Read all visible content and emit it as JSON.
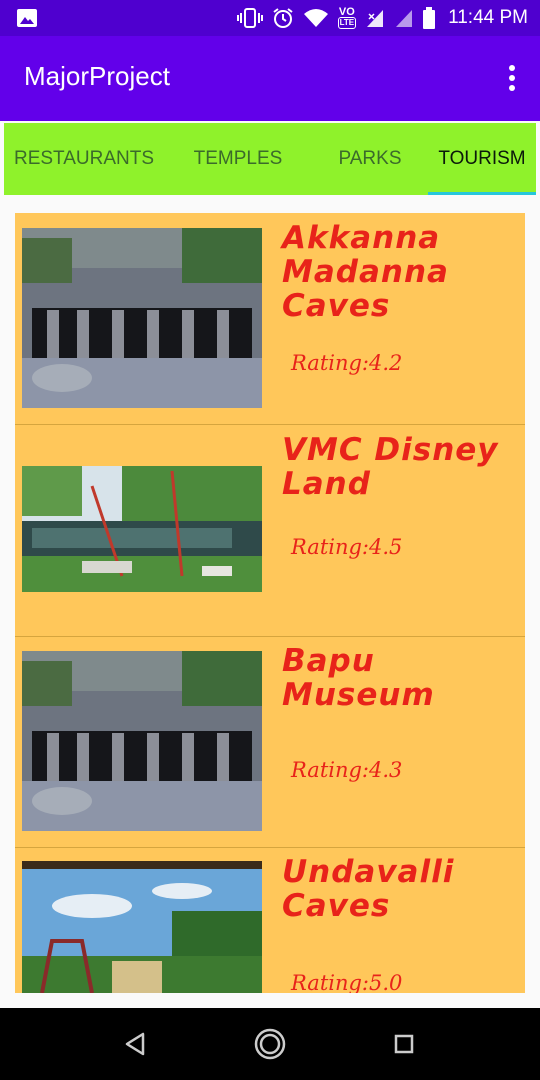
{
  "status_bar": {
    "time": "11:44 PM",
    "icons": [
      "gallery-icon",
      "vibrate-icon",
      "alarm-icon",
      "wifi-icon",
      "volte-icon",
      "signal-icon",
      "signal-icon",
      "battery-icon"
    ],
    "volte_label": "VO",
    "lte_label": "LTE"
  },
  "app_bar": {
    "title": "MajorProject",
    "menu_icon": "overflow-menu-icon"
  },
  "tabs": [
    {
      "label": "RESTAURANTS",
      "active": false
    },
    {
      "label": "TEMPLES",
      "active": false
    },
    {
      "label": "PARKS",
      "active": false
    },
    {
      "label": "TOURISM",
      "active": true
    }
  ],
  "places": [
    {
      "name": "Akkanna Madanna Caves",
      "rating": "Rating:4.2",
      "image": "cave-photo"
    },
    {
      "name": "VMC Disney Land",
      "rating": "Rating:4.5",
      "image": "park-photo"
    },
    {
      "name": "Bapu Museum",
      "rating": "Rating:4.3",
      "image": "cave-photo"
    },
    {
      "name": "Undavalli Caves",
      "rating": "Rating:5.0",
      "image": "amusement-park-photo"
    }
  ],
  "nav_bar": {
    "buttons": [
      "back-icon",
      "home-icon",
      "recents-icon"
    ]
  },
  "colors": {
    "status_bar": "#4f00cf",
    "app_bar": "#6200ea",
    "tabs_bg": "#8ff22b",
    "tab_indicator": "#26c6da",
    "card_bg": "#ffc75a",
    "text_red": "#e8231a"
  }
}
